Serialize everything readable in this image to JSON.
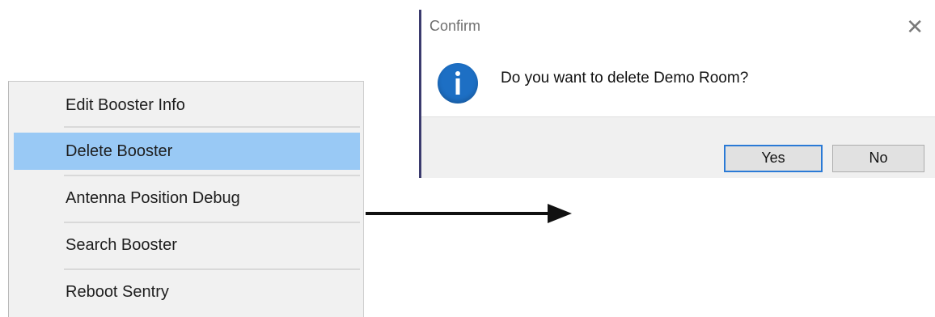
{
  "context_menu": {
    "items": [
      {
        "label": "Edit Booster Info",
        "selected": false
      },
      {
        "label": "Delete Booster",
        "selected": true
      },
      {
        "label": "Antenna Position Debug",
        "selected": false
      },
      {
        "label": "Search Booster",
        "selected": false
      },
      {
        "label": "Reboot Sentry",
        "selected": false
      }
    ],
    "highlight_color": "#99c9f5"
  },
  "dialog": {
    "title": "Confirm",
    "close_symbol": "✕",
    "icon": "info-icon",
    "icon_color": "#1d6fc4",
    "message": "Do you want to delete Demo Room?",
    "buttons": {
      "yes_label": "Yes",
      "no_label": "No"
    }
  },
  "arrow": {
    "icon": "right-arrow",
    "color": "#111111"
  }
}
